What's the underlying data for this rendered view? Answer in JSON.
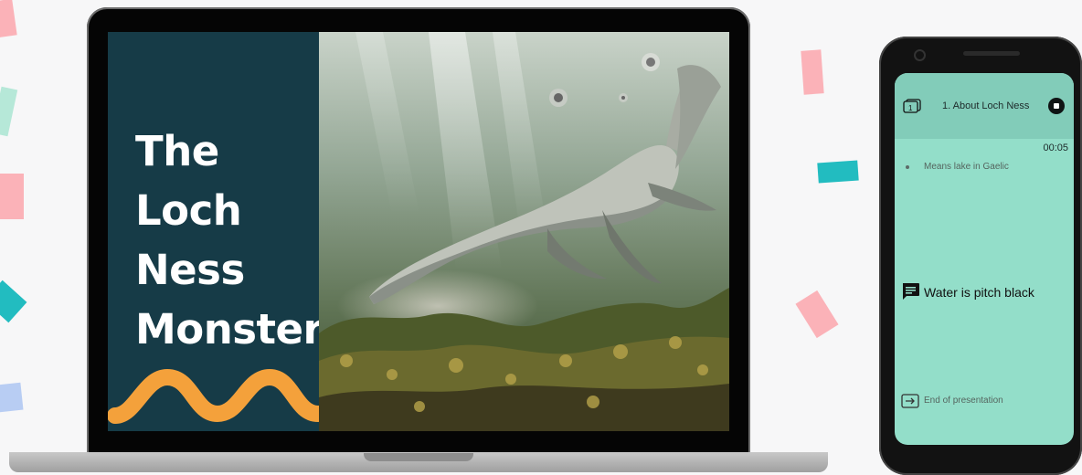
{
  "slide": {
    "title": "The\nLoch\nNess\nMonster",
    "colors": {
      "panel": "#163b47",
      "squiggle": "#f4a13b",
      "title": "#ffffff"
    },
    "image": "underwater-plesiosaur-illustration"
  },
  "phone": {
    "slide_name": "1. About Loch Ness",
    "slide_icon": "slide-number-icon",
    "slide_number": "1",
    "stop_icon": "stop-icon",
    "timer": "00:05",
    "note": "Means lake in Gaelic",
    "comment_icon": "comment-icon",
    "comment": "Water is pitch black",
    "end_icon": "exit-icon",
    "end_label": "End of presentation",
    "colors": {
      "screen": "#93dec9",
      "header": "#82ccb9"
    }
  },
  "confetti_colors": [
    "#fbb2b8",
    "#b6e8d8",
    "#22bcc0",
    "#b8cdf3"
  ]
}
